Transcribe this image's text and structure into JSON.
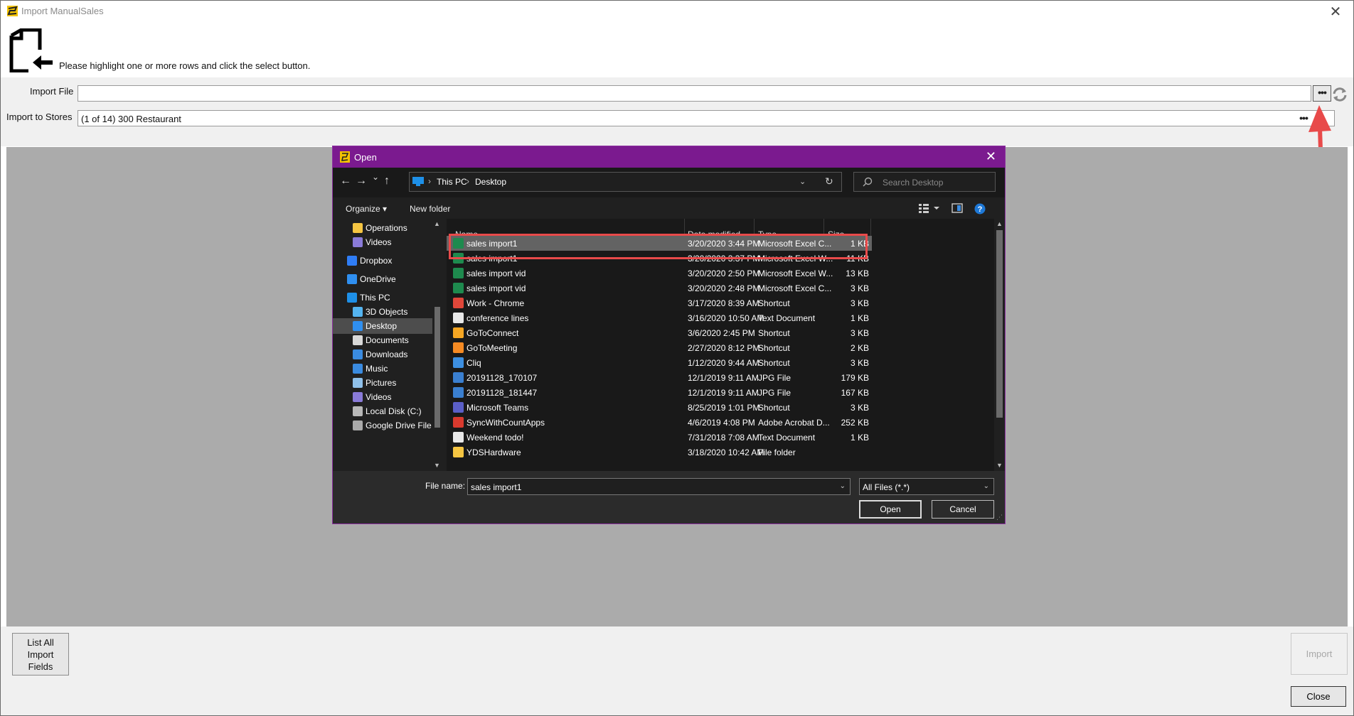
{
  "window": {
    "title": "Import ManualSales",
    "close_glyph": "✕",
    "instruction": "Please highlight one or more rows and click the select button."
  },
  "form": {
    "import_file_label": "Import File",
    "import_file_value": "",
    "import_stores_label": "Import to Stores",
    "import_stores_value": "(1 of 14) 300 Restaurant",
    "ellipsis": "•••"
  },
  "buttons": {
    "list_fields": "List All Import Fields",
    "import": "Import",
    "close": "Close"
  },
  "dialog": {
    "title": "Open",
    "close_glyph": "✕",
    "nav": {
      "back": "←",
      "forward": "→",
      "recent": "⌄",
      "up": "↑"
    },
    "breadcrumb": [
      "This PC",
      "Desktop"
    ],
    "breadcrumb_sep": "›",
    "dropdown_glyph": "⌄",
    "refresh_glyph": "↻",
    "search_placeholder": "Search Desktop",
    "organize": "Organize ▾",
    "new_folder": "New folder",
    "nav_items": [
      {
        "label": "Operations",
        "icon": "folder-user-icon",
        "indent": 1
      },
      {
        "label": "Videos",
        "icon": "video-folder-icon",
        "indent": 1
      },
      {
        "label": "Dropbox",
        "icon": "dropbox-icon",
        "indent": 0
      },
      {
        "label": "OneDrive",
        "icon": "onedrive-icon",
        "indent": 0
      },
      {
        "label": "This PC",
        "icon": "pc-icon",
        "indent": 0
      },
      {
        "label": "3D Objects",
        "icon": "3d-objects-icon",
        "indent": 1
      },
      {
        "label": "Desktop",
        "icon": "desktop-icon",
        "indent": 1,
        "selected": true
      },
      {
        "label": "Documents",
        "icon": "documents-icon",
        "indent": 1
      },
      {
        "label": "Downloads",
        "icon": "downloads-icon",
        "indent": 1
      },
      {
        "label": "Music",
        "icon": "music-icon",
        "indent": 1
      },
      {
        "label": "Pictures",
        "icon": "pictures-icon",
        "indent": 1
      },
      {
        "label": "Videos",
        "icon": "video-folder-icon",
        "indent": 1
      },
      {
        "label": "Local Disk (C:)",
        "icon": "disk-icon",
        "indent": 1
      },
      {
        "label": "Google Drive File",
        "icon": "drive-icon",
        "indent": 1
      }
    ],
    "columns": {
      "name": "Name",
      "date": "Date modified",
      "type": "Type",
      "size": "Size"
    },
    "files": [
      {
        "name": "sales import1",
        "date": "3/20/2020 3:44 PM",
        "type": "Microsoft Excel C...",
        "size": "1 KB",
        "icon": "excel-icon",
        "selected": true
      },
      {
        "name": "sales import1",
        "date": "3/20/2020 3:37 PM",
        "type": "Microsoft Excel W...",
        "size": "11 KB",
        "icon": "excel-icon"
      },
      {
        "name": "sales import vid",
        "date": "3/20/2020 2:50 PM",
        "type": "Microsoft Excel W...",
        "size": "13 KB",
        "icon": "excel-icon"
      },
      {
        "name": "sales import vid",
        "date": "3/20/2020 2:48 PM",
        "type": "Microsoft Excel C...",
        "size": "3 KB",
        "icon": "excel-icon"
      },
      {
        "name": "Work - Chrome",
        "date": "3/17/2020 8:39 AM",
        "type": "Shortcut",
        "size": "3 KB",
        "icon": "chrome-icon"
      },
      {
        "name": "conference lines",
        "date": "3/16/2020 10:50 AM",
        "type": "Text Document",
        "size": "1 KB",
        "icon": "text-document-icon"
      },
      {
        "name": "GoToConnect",
        "date": "3/6/2020 2:45 PM",
        "type": "Shortcut",
        "size": "3 KB",
        "icon": "gotoconnect-icon"
      },
      {
        "name": "GoToMeeting",
        "date": "2/27/2020 8:12 PM",
        "type": "Shortcut",
        "size": "2 KB",
        "icon": "gotomeeting-icon"
      },
      {
        "name": "Cliq",
        "date": "1/12/2020 9:44 AM",
        "type": "Shortcut",
        "size": "3 KB",
        "icon": "cliq-icon"
      },
      {
        "name": "20191128_170107",
        "date": "12/1/2019 9:11 AM",
        "type": "JPG File",
        "size": "179 KB",
        "icon": "image-icon"
      },
      {
        "name": "20191128_181447",
        "date": "12/1/2019 9:11 AM",
        "type": "JPG File",
        "size": "167 KB",
        "icon": "image-icon"
      },
      {
        "name": "Microsoft Teams",
        "date": "8/25/2019 1:01 PM",
        "type": "Shortcut",
        "size": "3 KB",
        "icon": "teams-icon"
      },
      {
        "name": "SyncWithCountApps",
        "date": "4/6/2019 4:08 PM",
        "type": "Adobe Acrobat D...",
        "size": "252 KB",
        "icon": "pdf-icon"
      },
      {
        "name": "Weekend todo!",
        "date": "7/31/2018 7:08 AM",
        "type": "Text Document",
        "size": "1 KB",
        "icon": "text-document-icon"
      },
      {
        "name": "YDSHardware",
        "date": "3/18/2020 10:42 AM",
        "type": "File folder",
        "size": "",
        "icon": "folder-icon"
      }
    ],
    "file_name_label": "File name:",
    "file_name_value": "sales import1",
    "file_filter": "All Files (*.*)",
    "open_btn": "Open",
    "cancel_btn": "Cancel"
  },
  "colors": {
    "dialog_title_bg": "#7b1a8f",
    "highlight_box": "#e84a4a",
    "annotation_arrow": "#e84a4a"
  }
}
